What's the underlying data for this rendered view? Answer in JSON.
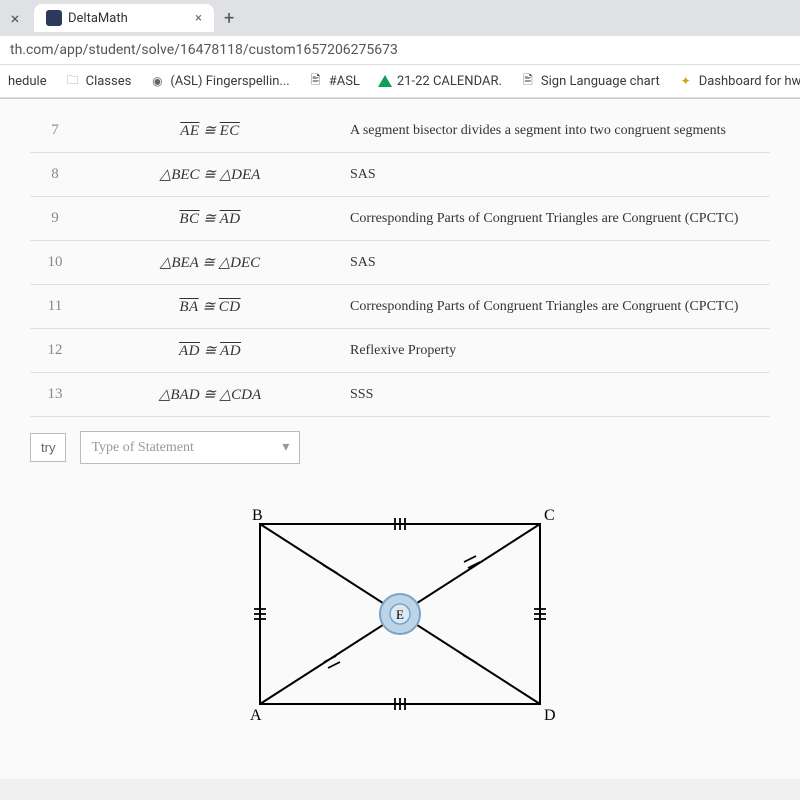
{
  "browser": {
    "tab_title": "DeltaMath",
    "url": "th.com/app/student/solve/16478118/custom1657206275673"
  },
  "bookmarks": [
    {
      "label": "hedule"
    },
    {
      "label": "Classes"
    },
    {
      "label": "(ASL) Fingerspellin..."
    },
    {
      "label": "#ASL"
    },
    {
      "label": "21-22 CALENDAR."
    },
    {
      "label": "Sign Language chart"
    },
    {
      "label": "Dashboard for hw"
    }
  ],
  "proof_rows": [
    {
      "num": "7",
      "statement": "AE ≅ EC",
      "statement_type": "segments",
      "reason": "A segment bisector divides a segment into two congruent segments"
    },
    {
      "num": "8",
      "statement": "△BEC ≅ △DEA",
      "statement_type": "triangles",
      "reason": "SAS"
    },
    {
      "num": "9",
      "statement": "BC ≅ AD",
      "statement_type": "segments",
      "reason": "Corresponding Parts of Congruent Triangles are Congruent (CPCTC)"
    },
    {
      "num": "10",
      "statement": "△BEA ≅ △DEC",
      "statement_type": "triangles",
      "reason": "SAS"
    },
    {
      "num": "11",
      "statement": "BA ≅ CD",
      "statement_type": "segments",
      "reason": "Corresponding Parts of Congruent Triangles are Congruent (CPCTC)"
    },
    {
      "num": "12",
      "statement": "AD ≅ AD",
      "statement_type": "segments",
      "reason": "Reflexive Property"
    },
    {
      "num": "13",
      "statement": "△BAD ≅ △CDA",
      "statement_type": "triangles",
      "reason": "SSS"
    }
  ],
  "input": {
    "try_label": "try",
    "select_placeholder": "Type of Statement"
  },
  "figure": {
    "labels": {
      "tl": "B",
      "tr": "C",
      "bl": "A",
      "br": "D",
      "center": "E"
    }
  }
}
